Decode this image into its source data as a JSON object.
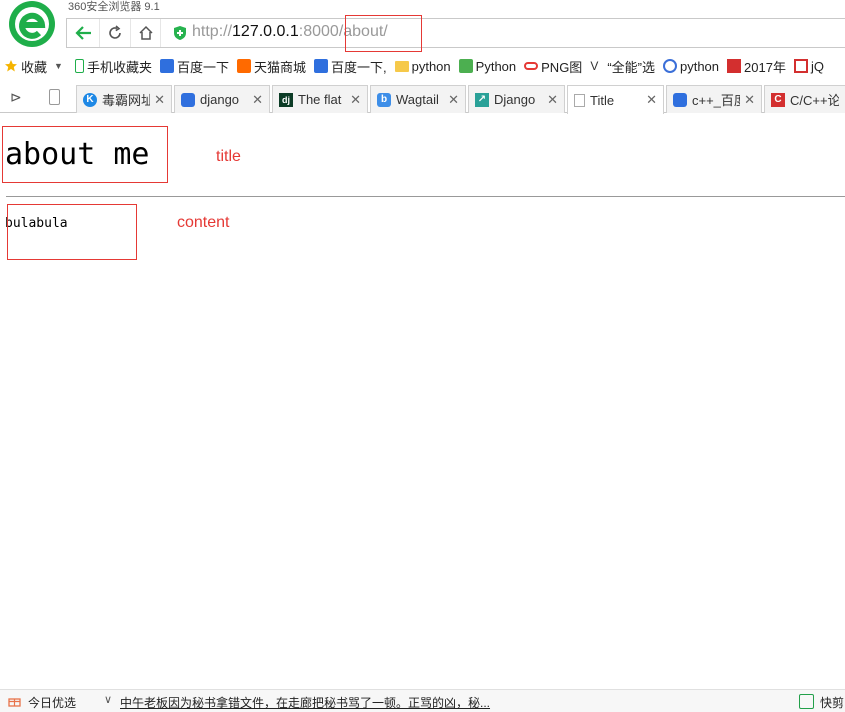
{
  "window": {
    "app_title": "360安全浏览器 9.1"
  },
  "address_bar": {
    "url_scheme": "http://",
    "url_host": "127.0.0.1",
    "url_port": ":8000",
    "url_path": "/about/"
  },
  "bookmarks": {
    "favorites_label": "收藏",
    "items": [
      {
        "label": "手机收藏夹",
        "icon": "phone-icon"
      },
      {
        "label": "百度一下",
        "icon": "baidu-icon"
      },
      {
        "label": "天猫商城",
        "icon": "tmall-icon"
      },
      {
        "label": "百度一下,",
        "icon": "baidu-icon"
      },
      {
        "label": "python",
        "icon": "folder-icon"
      },
      {
        "label": "Python",
        "icon": "python-icon"
      },
      {
        "label": "PNG图",
        "icon": "png-icon"
      },
      {
        "label": "“全能”选",
        "icon": "v-icon"
      },
      {
        "label": "python",
        "icon": "chain-icon"
      },
      {
        "label": "2017年",
        "icon": "calendar-icon"
      },
      {
        "label": "jQ",
        "icon": "jq-icon"
      }
    ]
  },
  "tabs": [
    {
      "label": "毒霸网址",
      "icon": "k-icon",
      "color": "#1e88e5"
    },
    {
      "label": "django",
      "icon": "baidu-icon",
      "color": "#2f6fde"
    },
    {
      "label": "The flat",
      "icon": "dj-icon",
      "color": "#0c3c26"
    },
    {
      "label": "Wagtail",
      "icon": "b-icon",
      "color": "#3d8ee8"
    },
    {
      "label": "Django",
      "icon": "feather-icon",
      "color": "#2aa198"
    },
    {
      "label": "Title",
      "icon": "page-icon",
      "color": "#cccccc"
    },
    {
      "label": "c++_百度",
      "icon": "baidu-icon",
      "color": "#2f6fde"
    },
    {
      "label": "C/C++论",
      "icon": "c-icon",
      "color": "#d32f2f"
    }
  ],
  "page": {
    "heading": "about me",
    "title_annotation": "title",
    "content_text": "bulabula",
    "content_annotation": "content"
  },
  "statusbar": {
    "today_label": "今日优选",
    "news_text": "中午老板因为秘书拿错文件，在走廊把秘书骂了一顿。正骂的凶，秘...",
    "quick_label": "快剪"
  },
  "colors": {
    "annotation_red": "#e53935",
    "logo_green": "#1fae4a"
  }
}
